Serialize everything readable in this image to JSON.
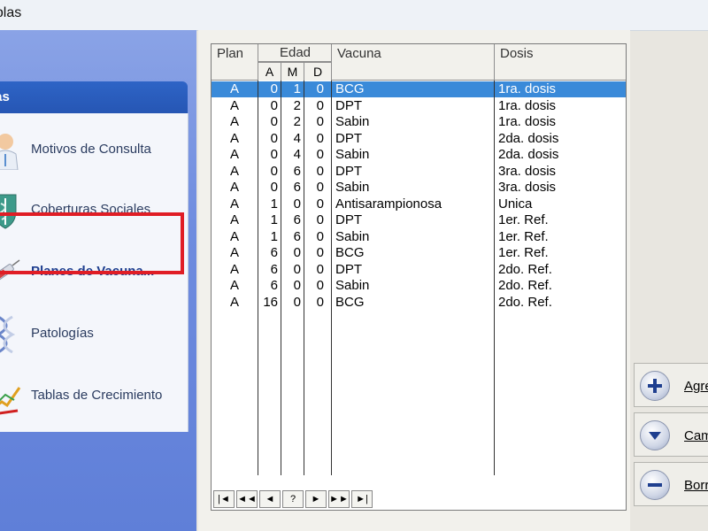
{
  "window": {
    "title": "ablas"
  },
  "sidebar": {
    "group_title": "las",
    "items": [
      {
        "label": "Motivos de Consulta",
        "icon": "doctor-icon"
      },
      {
        "label": "Coberturas Sociales",
        "icon": "shield-caduceus-icon"
      },
      {
        "label": "Planes de Vacuna...",
        "icon": "syringe-icon",
        "active": true
      },
      {
        "label": "Patologías",
        "icon": "dna-icon"
      },
      {
        "label": "Tablas de Crecimiento",
        "icon": "growth-chart-icon"
      }
    ]
  },
  "grid": {
    "headers": {
      "plan": "Plan",
      "edad": "Edad",
      "a": "A",
      "m": "M",
      "d": "D",
      "vacuna": "Vacuna",
      "dosis": "Dosis"
    },
    "rows": [
      {
        "plan": "A",
        "a": "0",
        "m": "1",
        "d": "0",
        "vacuna": "BCG",
        "dosis": "1ra. dosis"
      },
      {
        "plan": "A",
        "a": "0",
        "m": "2",
        "d": "0",
        "vacuna": "DPT",
        "dosis": "1ra. dosis"
      },
      {
        "plan": "A",
        "a": "0",
        "m": "2",
        "d": "0",
        "vacuna": "Sabin",
        "dosis": "1ra. dosis"
      },
      {
        "plan": "A",
        "a": "0",
        "m": "4",
        "d": "0",
        "vacuna": "DPT",
        "dosis": "2da. dosis"
      },
      {
        "plan": "A",
        "a": "0",
        "m": "4",
        "d": "0",
        "vacuna": "Sabin",
        "dosis": "2da. dosis"
      },
      {
        "plan": "A",
        "a": "0",
        "m": "6",
        "d": "0",
        "vacuna": "DPT",
        "dosis": "3ra. dosis"
      },
      {
        "plan": "A",
        "a": "0",
        "m": "6",
        "d": "0",
        "vacuna": "Sabin",
        "dosis": "3ra. dosis"
      },
      {
        "plan": "A",
        "a": "1",
        "m": "0",
        "d": "0",
        "vacuna": "Antisarampionosa",
        "dosis": "Unica"
      },
      {
        "plan": "A",
        "a": "1",
        "m": "6",
        "d": "0",
        "vacuna": "DPT",
        "dosis": "1er. Ref."
      },
      {
        "plan": "A",
        "a": "1",
        "m": "6",
        "d": "0",
        "vacuna": "Sabin",
        "dosis": "1er. Ref."
      },
      {
        "plan": "A",
        "a": "6",
        "m": "0",
        "d": "0",
        "vacuna": "BCG",
        "dosis": "1er. Ref."
      },
      {
        "plan": "A",
        "a": "6",
        "m": "0",
        "d": "0",
        "vacuna": "DPT",
        "dosis": "2do. Ref."
      },
      {
        "plan": "A",
        "a": "6",
        "m": "0",
        "d": "0",
        "vacuna": "Sabin",
        "dosis": "2do. Ref."
      },
      {
        "plan": "A",
        "a": "16",
        "m": "0",
        "d": "0",
        "vacuna": "BCG",
        "dosis": "2do. Ref."
      }
    ],
    "selected_row": 0,
    "navigator": [
      "|◄",
      "◄◄",
      "◄",
      "?",
      "►",
      "►►",
      "►|"
    ]
  },
  "actions": [
    {
      "label": "Agre",
      "icon": "plus-icon"
    },
    {
      "label": "Cam",
      "icon": "chevron-down-icon"
    },
    {
      "label": "Borr",
      "icon": "minus-icon"
    }
  ],
  "colors": {
    "highlight": "#e01d25",
    "selection": "#3a8ad9",
    "sidebar_header": "#2e64c6"
  }
}
